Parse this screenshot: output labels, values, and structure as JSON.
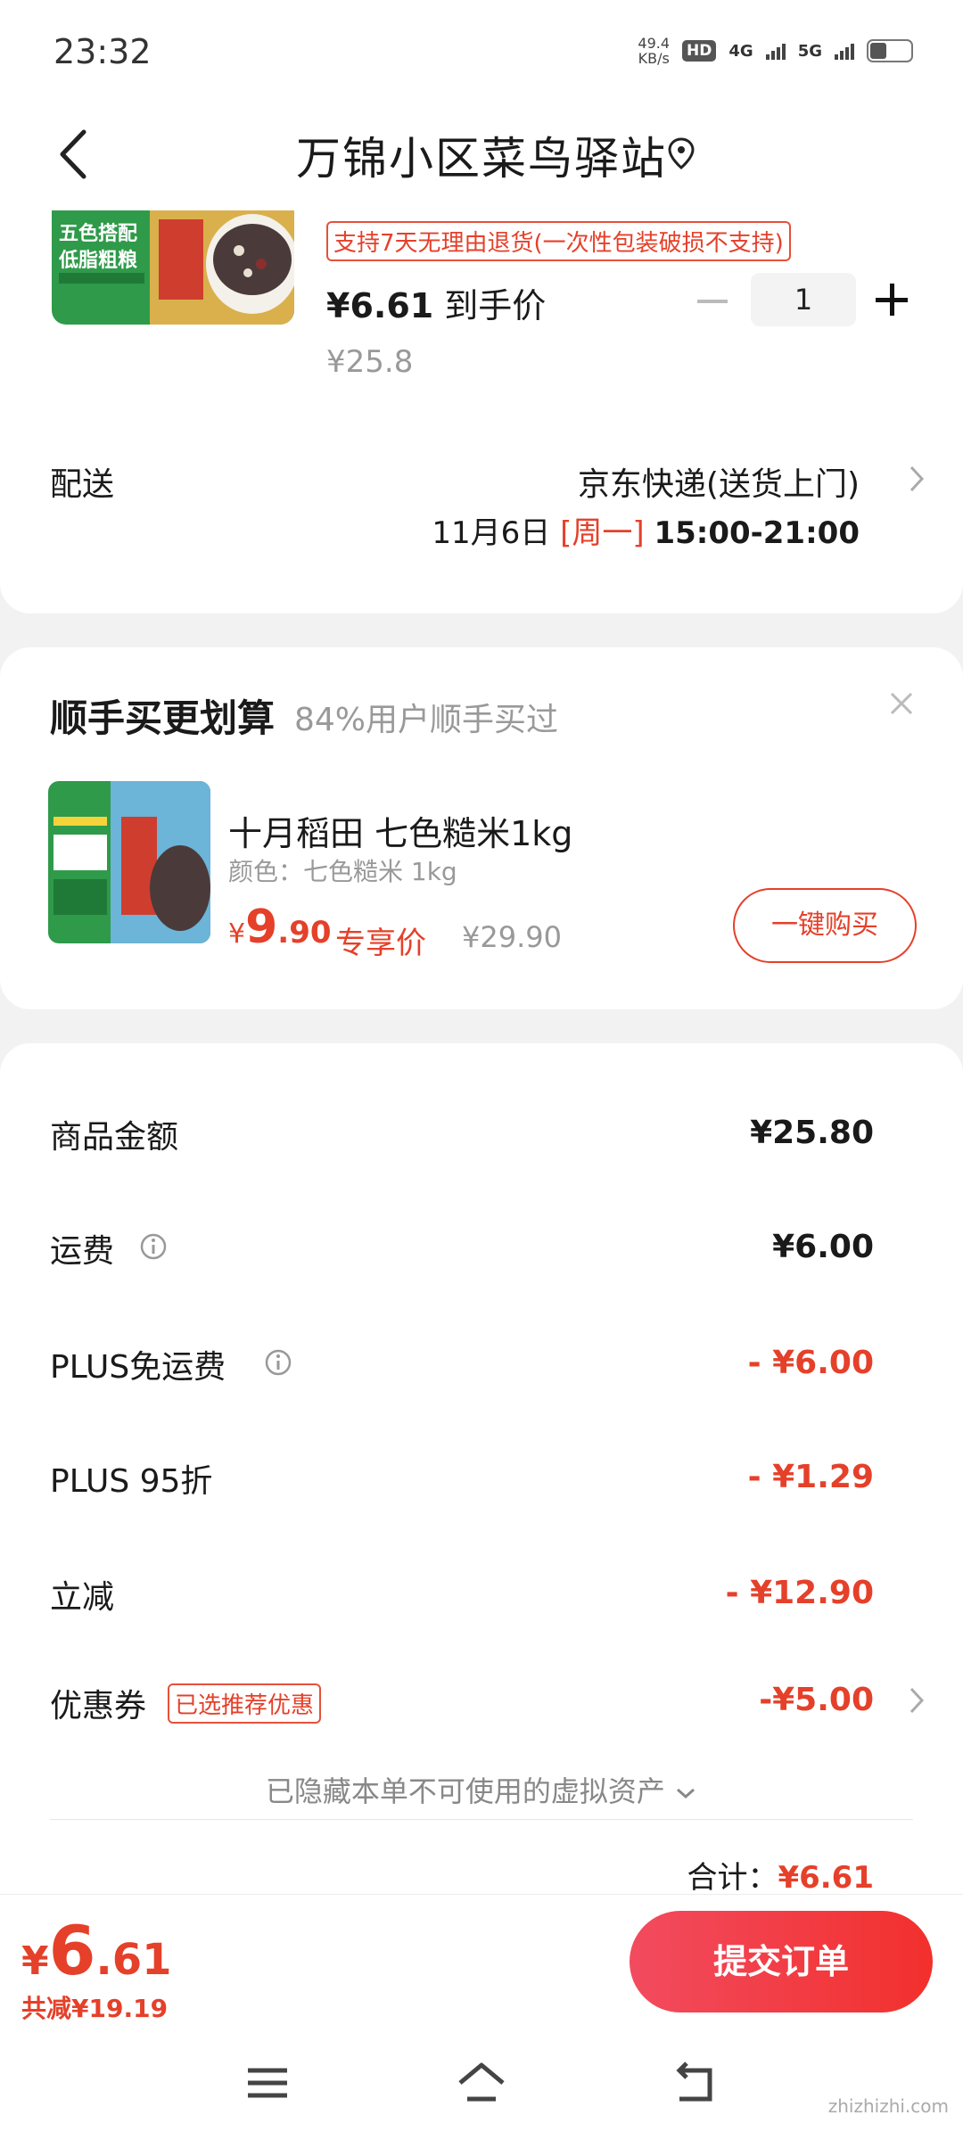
{
  "status_bar": {
    "time": "23:32",
    "speed_value": "49.4",
    "speed_unit": "KB/s",
    "hd": "HD",
    "net1": "4G",
    "net2": "5G"
  },
  "header": {
    "title": "万锦小区菜鸟驿站"
  },
  "product": {
    "return_policy": "支持7天无理由退货(一次性包装破损不支持)",
    "hand_price": "¥6.61",
    "hand_price_label": "到手价",
    "original_price": "¥25.8",
    "quantity": "1",
    "image_text": "五色搭配\n低脂粗粮"
  },
  "shipping": {
    "label": "配送",
    "method": "京东快递(送货上门)",
    "date": "11月6日",
    "weekday": "[周一]",
    "time_range": "15:00-21:00"
  },
  "recommend": {
    "title": "顺手买更划算",
    "subtitle": "84%用户顺手买过",
    "product_name": "十月稻田 七色糙米1kg",
    "color": "颜色：七色糙米 1kg",
    "price_symbol": "¥",
    "price_int": "9",
    "price_dec": ".90",
    "exclusive_label": "专享价",
    "old_price": "¥29.90",
    "buy_button": "一键购买"
  },
  "summary": {
    "rows": [
      {
        "label": "商品金额",
        "value": "¥25.80"
      },
      {
        "label": "运费",
        "value": "¥6.00"
      },
      {
        "label": "PLUS免运费",
        "value": "- ¥6.00"
      },
      {
        "label": "PLUS 95折",
        "value": "- ¥1.29"
      },
      {
        "label": "立减",
        "value": "- ¥12.90"
      },
      {
        "label": "优惠券",
        "value": "-¥5.00"
      }
    ],
    "coupon_tag": "已选推荐优惠",
    "hidden_note": "已隐藏本单不可使用的虚拟资产",
    "total_label": "合计：",
    "total_value": "¥6.61"
  },
  "bottom": {
    "yen": "¥",
    "price_int": "6",
    "price_dec": ".61",
    "saved": "共减¥19.19",
    "submit": "提交订单"
  },
  "watermark": "zhizhizhi.com",
  "colors": {
    "accent": "#e5402a",
    "submit_start": "#f24b5f",
    "submit_end": "#f2302d"
  }
}
